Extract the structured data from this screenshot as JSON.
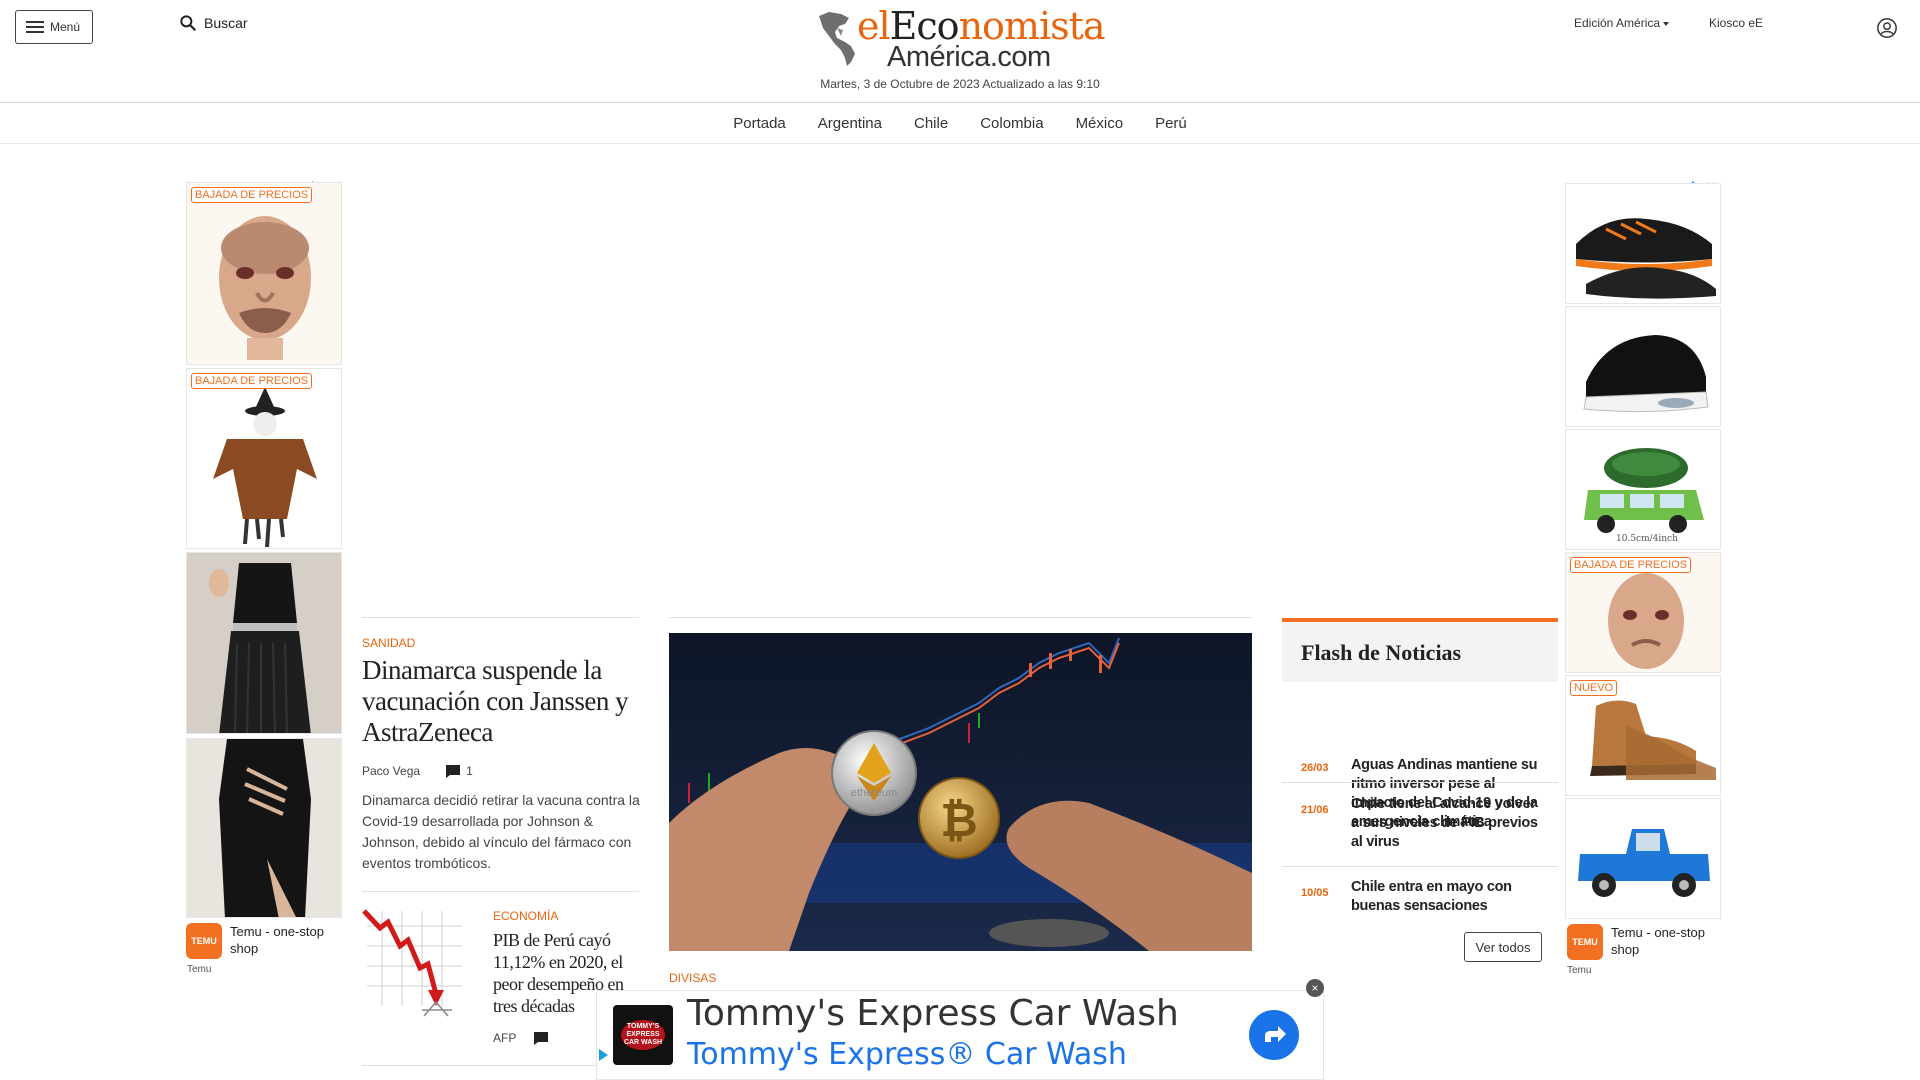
{
  "header": {
    "menu_label": "Menú",
    "search_label": "Buscar",
    "logo_line1_el": "el",
    "logo_line1_eco": "Eco",
    "logo_line1_nomista": "nomista",
    "logo_line2": "América.com",
    "dateline": "Martes, 3 de Octubre de 2023 Actualizado a las 9:10",
    "edition_label": "Edición América",
    "kiosco_label": "Kiosco eE"
  },
  "nav": {
    "items": [
      "Portada",
      "Argentina",
      "Chile",
      "Colombia",
      "México",
      "Perú"
    ]
  },
  "left_ad": {
    "badges": [
      "BAJADA DE PRECIOS",
      "BAJADA DE PRECIOS"
    ],
    "brand": "Temu - one-stop shop",
    "brand_sub": "Temu",
    "logo_text": "TEMU"
  },
  "right_ad": {
    "badges": [
      "BAJADA DE PRECIOS",
      "NUEVO"
    ],
    "caption": "10.5cm/4inch",
    "brand": "Temu - one-stop shop",
    "brand_sub": "Temu",
    "logo_text": "TEMU"
  },
  "lead_story": {
    "kicker": "SANIDAD",
    "headline": "Dinamarca suspende la vacunación con Janssen y AstraZeneca",
    "author": "Paco Vega",
    "comments": "1",
    "summary": "Dinamarca decidió retirar la vacuna contra la Covid-19 desarrollada por Johnson & Johnson, debido al vínculo del fármaco con eventos trombóticos."
  },
  "second_story": {
    "kicker": "ECONOMÍA",
    "headline": "PIB de Perú cayó 11,12% en 2020, el peor desempeño en tres décadas",
    "author": "AFP"
  },
  "hero_story": {
    "kicker": "DIVISAS",
    "coin1_label": "ethereum"
  },
  "flash": {
    "title": "Flash de Noticias",
    "items": [
      {
        "date": "26/03",
        "title": "Aguas Andinas mantiene su ritmo inversor pese al impacto del Covid-19 y de la emergencia climática"
      },
      {
        "date": "21/06",
        "title": "Chile tiene al alcance volver a sus niveles de PIB previos al virus"
      },
      {
        "date": "10/05",
        "title": "Chile entra en mayo con buenas sensaciones"
      }
    ],
    "see_all": "Ver todos"
  },
  "bottom_ad": {
    "title": "Tommy's Express Car Wash",
    "subtitle": "Tommy's Express® Car Wash",
    "logo_text": "TOMMY'S EXPRESS CAR WASH",
    "close": "×"
  }
}
